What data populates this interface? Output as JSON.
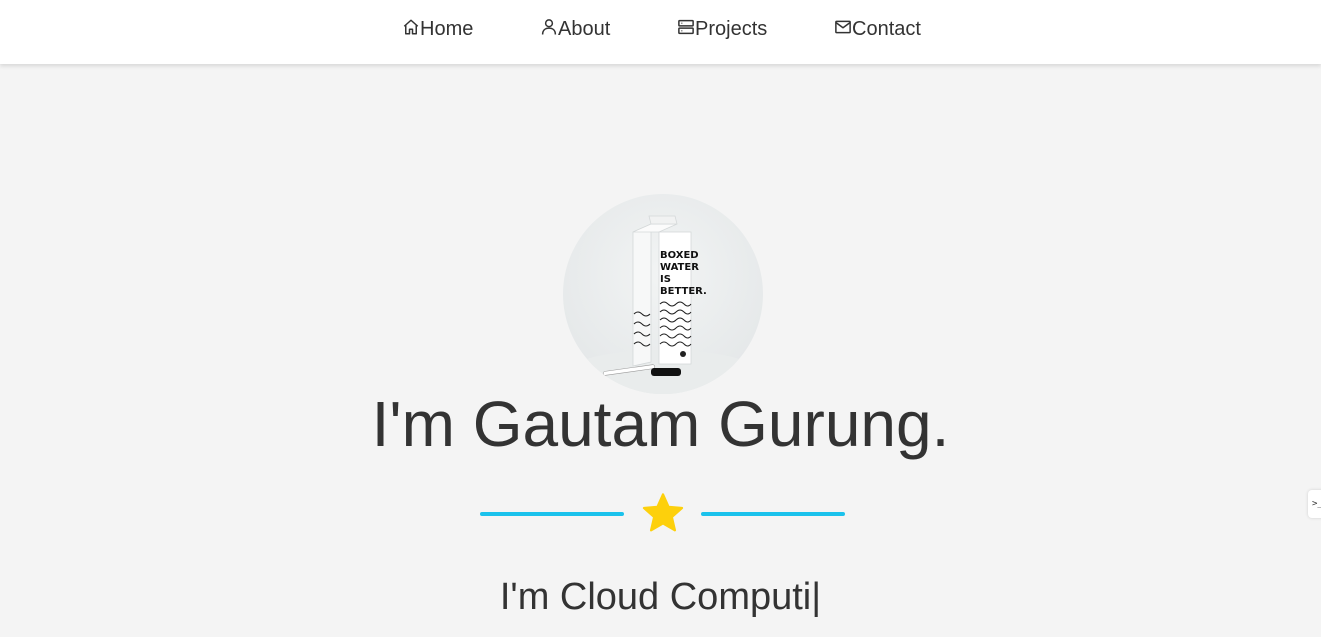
{
  "nav": {
    "items": [
      {
        "label": "Home",
        "icon": "home-icon"
      },
      {
        "label": "About",
        "icon": "user-icon"
      },
      {
        "label": "Projects",
        "icon": "server-icon"
      },
      {
        "label": "Contact",
        "icon": "mail-icon"
      }
    ]
  },
  "hero": {
    "avatar_image": "boxed-water-carton-photo",
    "avatar_printed_text": [
      "BOXED",
      "WATER",
      "IS",
      "BETTER."
    ],
    "title": "I'm Gautam Gurung.",
    "divider_icon": "star-icon",
    "typed_text": "I'm Cloud Computi|"
  },
  "side_tab": {
    "icon": "code-icon",
    "label": ">_"
  },
  "colors": {
    "background": "#f4f4f4",
    "navbar": "#ffffff",
    "text": "#333333",
    "divider": "#1bc2ec",
    "star": "#fdd00c"
  }
}
